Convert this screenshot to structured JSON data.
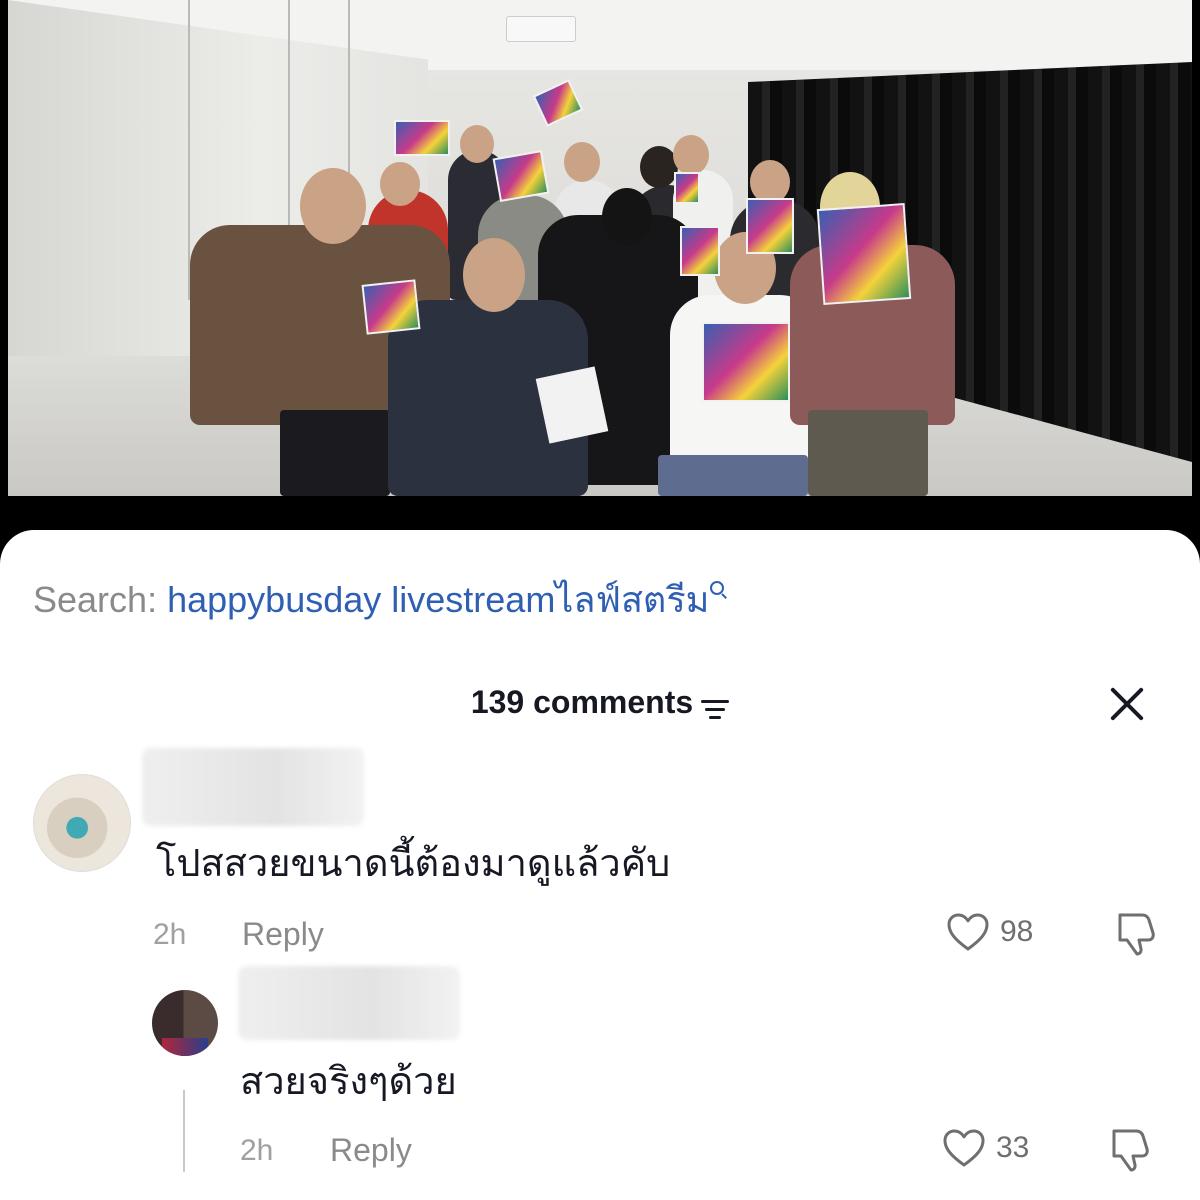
{
  "search": {
    "label": "Search:",
    "term": "happybusday livestreamไลฟ์สตรีม",
    "icon": "search-icon"
  },
  "comments_header": {
    "count_label": "139 comments",
    "filter_icon": "filter-icon",
    "close_icon": "close-icon"
  },
  "comments": [
    {
      "text": "โปสสวยขนาดนี้ต้องมาดูแล้วคับ",
      "time": "2h",
      "reply_label": "Reply",
      "likes": "98"
    },
    {
      "text": "สวยจริงๆด้วย",
      "time": "2h",
      "reply_label": "Reply",
      "likes": "33"
    }
  ],
  "colors": {
    "accent_link": "#2f5fb3",
    "text_primary": "#161823",
    "text_secondary": "#8a8a8d"
  }
}
